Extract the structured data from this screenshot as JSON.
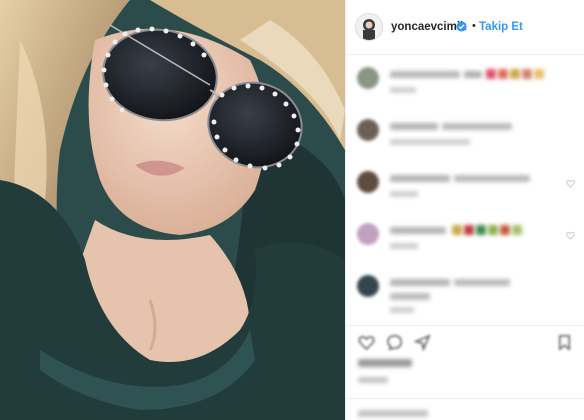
{
  "header": {
    "username": "yoncaevcimik",
    "follow_label": "Takip Et",
    "separator": "•",
    "more": "•••",
    "verified_color": "#3897f0"
  },
  "comments": [
    {
      "avatar_colors": [
        "#7d8a78",
        "#b9c2b0"
      ],
      "emoji_colors": [
        "#e0506a",
        "#e06a5a",
        "#c9a84a",
        "#d4806a",
        "#e8c06a",
        "#c25a7a",
        "#d49aa0"
      ]
    },
    {
      "avatar_colors": [
        "#6a5a50",
        "#b8a898"
      ],
      "emoji_colors": []
    },
    {
      "avatar_colors": [
        "#5a4a3a",
        "#a8887a"
      ],
      "emoji_colors": []
    },
    {
      "avatar_colors": [
        "#b08ab0",
        "#e0c8d8"
      ],
      "emoji_colors": [
        "#c8a84a",
        "#c03a3a",
        "#3a8a4a",
        "#8ab04a",
        "#c05a3a",
        "#a8c06a"
      ]
    },
    {
      "avatar_colors": [
        "#2a3a40",
        "#8aa0a8"
      ],
      "emoji_colors": []
    }
  ],
  "media": {
    "colors": {
      "background": "#2b4c4a",
      "skin": "#e9c9b4",
      "hair": "#c8a574",
      "jacket": "#213c3b",
      "lens": "#1a1d22",
      "studs": "#eeeeee"
    }
  },
  "icons": [
    "heart-icon",
    "comment-icon",
    "share-icon",
    "bookmark-icon"
  ]
}
